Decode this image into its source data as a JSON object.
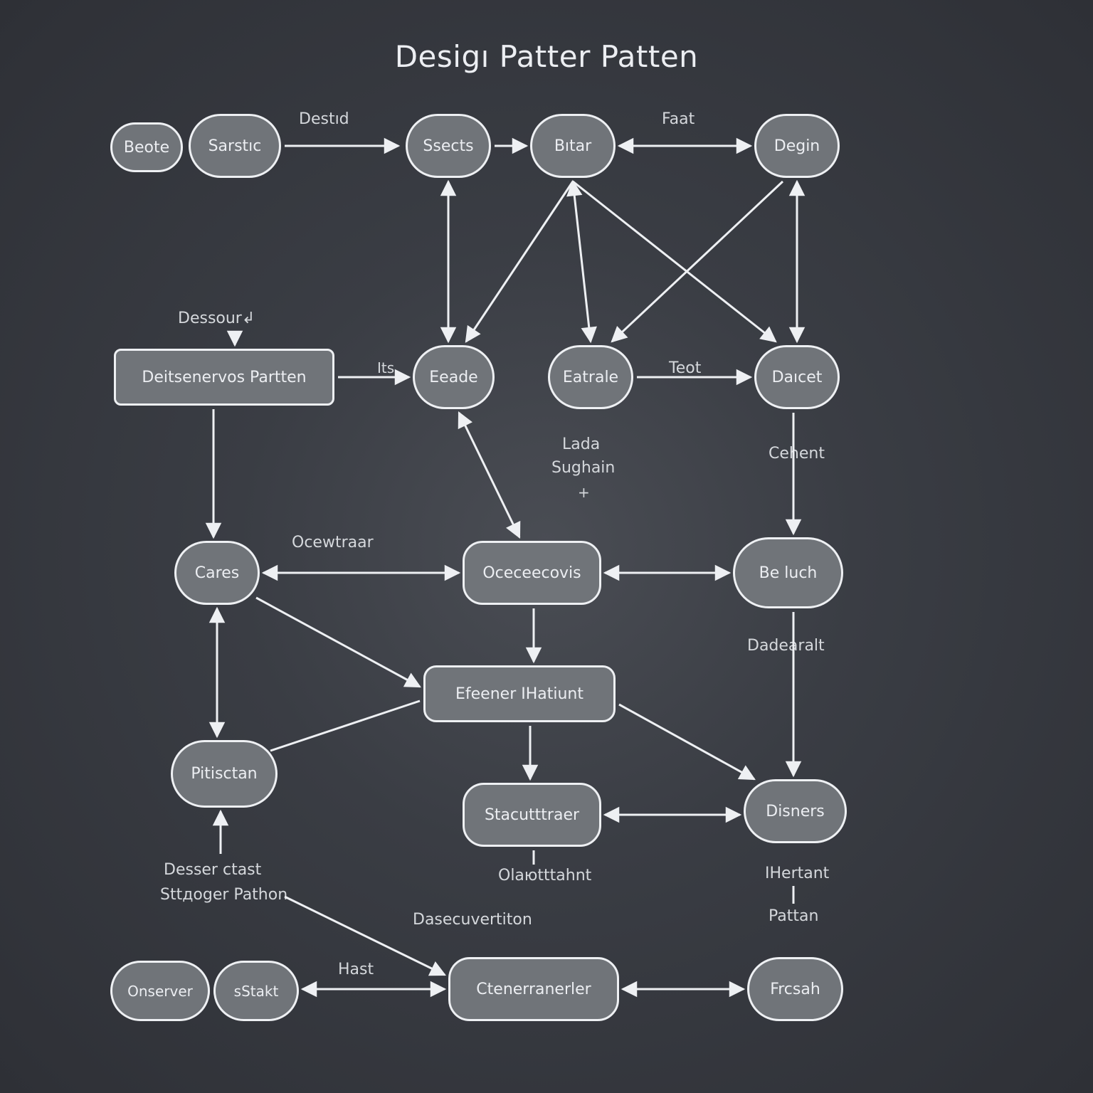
{
  "title": "Desigı Patter Patten",
  "nodes": {
    "beote": "Beote",
    "sarstic": "Sarstıc",
    "ssects": "Ssects",
    "bitar": "Bıtar",
    "degin": "Degin",
    "rectMain": "Deitsenervos Partten",
    "eeade": "Eeade",
    "eatrale": "Eatrale",
    "daicet": "Daıcet",
    "cares": "Cares",
    "oceec": "Oceceecovis",
    "beluch": "Be luch",
    "efeen": "Efeener IHatiunt",
    "pitis": "Pitisctan",
    "stacu": "Stacutttraer",
    "disners": "Disners",
    "onserver": "Onserver",
    "sstakt": "sStakt",
    "ctener": "Ctenerranerler",
    "frcsah": "Frcsah"
  },
  "labels": {
    "destd": "Destıd",
    "faat": "Faat",
    "dessour": "Dessour↲",
    "its": "Its",
    "teot": "Teot",
    "lada": "Lada",
    "sughain": "Sughain",
    "plus": "+",
    "cehent": "Cehent",
    "ocewraar": "Ocewtraar",
    "dadearail": "Dadearalt",
    "desserctast": "Desser ctast",
    "stroger": "Sttдoger Pathon",
    "olasor": "Olaюtttahnt",
    "dascu": "Dasecuvertiton",
    "ihertant": "IHertant",
    "pattan": "Pattan",
    "hast": "Hast"
  }
}
